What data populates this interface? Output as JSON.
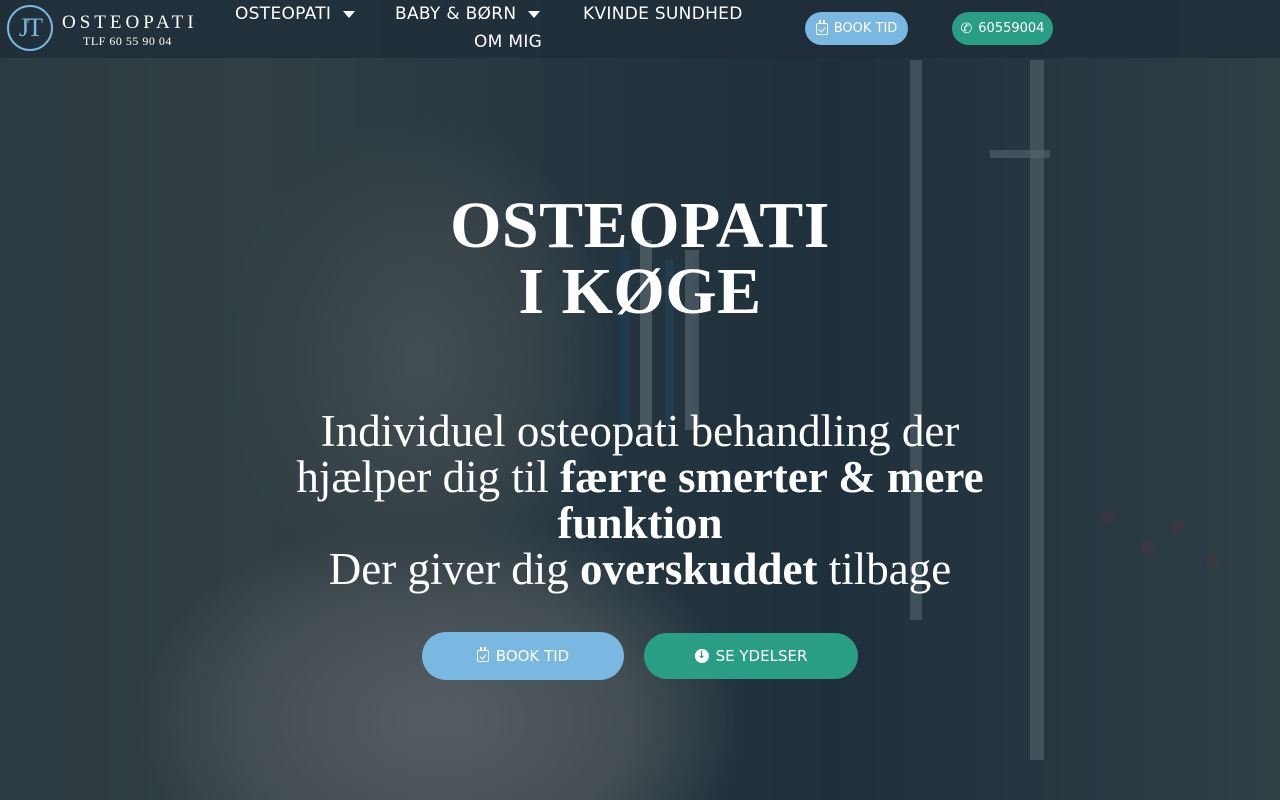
{
  "header": {
    "logo": {
      "monogram": "JT",
      "name": "OSTEOPATI",
      "phone": "TLF 60 55 90 04"
    },
    "nav": [
      {
        "label": "OSTEOPATI",
        "has_dropdown": true
      },
      {
        "label": "BABY & BØRN",
        "has_dropdown": true
      },
      {
        "label": "KVINDE SUNDHED",
        "has_dropdown": false
      },
      {
        "label": "OM MIG",
        "has_dropdown": false
      }
    ],
    "book_button": {
      "label": "BOOK TID",
      "icon": "calendar-check-icon"
    },
    "phone_button": {
      "label": "60559004",
      "icon": "phone-icon"
    }
  },
  "hero": {
    "title_line1": "OSTEOPATI",
    "title_line2": "I KØGE",
    "subtitle": {
      "line1": "Individuel osteopati behandling der",
      "line2_plain": "hjælper dig til ",
      "line2_bold": "færre smerter & mere funktion",
      "line3_plain_start": "Der giver dig ",
      "line3_bold": "overskuddet",
      "line3_plain_end": " tilbage"
    },
    "primary_cta": {
      "label": "BOOK TID",
      "icon": "calendar-check-icon"
    },
    "secondary_cta": {
      "label": "SE YDELSER",
      "icon": "arrow-down-circle-icon"
    }
  },
  "colors": {
    "accent_blue": "#7ab8e2",
    "accent_green": "#2a9d85",
    "header_bg": "#1e2d38",
    "text": "#ffffff"
  }
}
